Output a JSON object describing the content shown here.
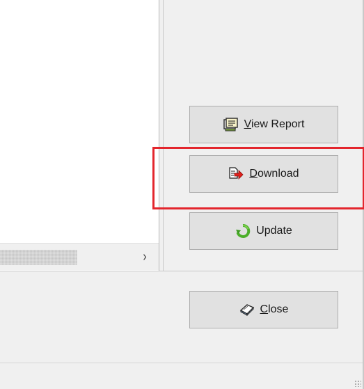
{
  "buttons": {
    "view_report": {
      "mnemonic": "V",
      "rest": "iew Report",
      "icon": "report-icon"
    },
    "download": {
      "mnemonic": "D",
      "rest": "ownload",
      "icon": "download-icon"
    },
    "update": {
      "label": "Update",
      "icon": "refresh-icon"
    },
    "close": {
      "mnemonic": "C",
      "rest": "lose",
      "icon": "close-book-icon"
    }
  },
  "scrollbar": {
    "right_arrow": "›"
  },
  "highlight_color": "#e3262d"
}
